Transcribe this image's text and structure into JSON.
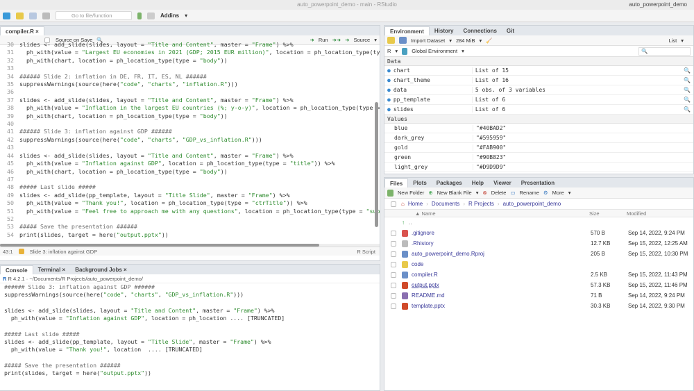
{
  "window": {
    "title": "auto_powerpoint_demo - main - RStudio",
    "project": "auto_powerpoint_demo"
  },
  "toolbar": {
    "goto_placeholder": "Go to file/function",
    "addins": "Addins"
  },
  "editor": {
    "tab": "compiler.R",
    "source_on_save": "Source on Save",
    "run": "Run",
    "source": "Source",
    "first_line": 30,
    "lines": [
      "slides <- add_slide(slides, layout = \"Title and Content\", master = \"Frame\") %>%",
      "  ph_with(value = \"Largest EU economies in 2021 (GDP; 2015 EUR million)\", location = ph_location_type(type",
      "  ph_with(chart, location = ph_location_type(type = \"body\"))",
      "",
      "###### Slide 2: inflation in DE, FR, IT, ES, NL ######",
      "suppressWarnings(source(here(\"code\", \"charts\", \"inflation.R\")))",
      "",
      "slides <- add_slide(slides, layout = \"Title and Content\", master = \"Frame\") %>%",
      "  ph_with(value = \"Inflation in the largest EU countries (%; y-o-y)\", location = ph_location_type(type = \"",
      "  ph_with(chart, location = ph_location_type(type = \"body\"))",
      "",
      "###### Slide 3: inflation against GDP ######",
      "suppressWarnings(source(here(\"code\", \"charts\", \"GDP_vs_inflation.R\")))",
      "",
      "slides <- add_slide(slides, layout = \"Title and Content\", master = \"Frame\") %>%",
      "  ph_with(value = \"Inflation against GDP\", location = ph_location_type(type = \"title\")) %>%",
      "  ph_with(chart, location = ph_location_type(type = \"body\"))",
      "",
      "##### Last slide #####",
      "slides <- add_slide(pp_template, layout = \"Title Slide\", master = \"Frame\") %>%",
      "  ph_with(value = \"Thank you!\", location = ph_location_type(type = \"ctrTitle\")) %>%",
      "  ph_with(value = \"Feel free to approach me with any questions\", location = ph_location_type(type = \"subTi",
      "",
      "##### Save the presentation ######",
      "print(slides, target = here(\"output.pptx\"))"
    ],
    "status_pos": "43:1",
    "status_section": "Slide 3: inflation against GDP",
    "status_type": "R Script"
  },
  "console": {
    "tabs": [
      "Console",
      "Terminal",
      "Background Jobs"
    ],
    "path": "R 4.2.1 · ~/Documents/R Projects/auto_powerpoint_demo/",
    "lines": [
      "###### Slide 3: inflation against GDP ######",
      "suppressWarnings(source(here(\"code\", \"charts\", \"GDP_vs_inflation.R\")))",
      "",
      "slides <- add_slide(slides, layout = \"Title and Content\", master = \"Frame\") %>%",
      "  ph_with(value = \"Inflation against GDP\", location = ph_location .... [TRUNCATED]",
      "",
      "##### Last slide #####",
      "slides <- add_slide(pp_template, layout = \"Title Slide\", master = \"Frame\") %>%",
      "  ph_with(value = \"Thank you!\", location  .... [TRUNCATED]",
      "",
      "##### Save the presentation ######",
      "print(slides, target = here(\"output.pptx\"))"
    ]
  },
  "environment": {
    "tabs": [
      "Environment",
      "History",
      "Connections",
      "Git"
    ],
    "import": "Import Dataset",
    "memory": "284 MiB",
    "view": "List",
    "lang": "R",
    "scope": "Global Environment",
    "data_header": "Data",
    "data": [
      [
        "chart",
        "List of  15"
      ],
      [
        "chart_theme",
        "List of  16"
      ],
      [
        "data",
        "5 obs. of 3 variables"
      ],
      [
        "pp_template",
        "List of  6"
      ],
      [
        "slides",
        "List of  6"
      ]
    ],
    "values_header": "Values",
    "values": [
      [
        "blue",
        "\"#40BAD2\""
      ],
      [
        "dark_grey",
        "\"#595959\""
      ],
      [
        "gold",
        "\"#FAB900\""
      ],
      [
        "green",
        "\"#90B823\""
      ],
      [
        "light_grey",
        "\"#D9D9D9\""
      ]
    ]
  },
  "files": {
    "tabs": [
      "Files",
      "Plots",
      "Packages",
      "Help",
      "Viewer",
      "Presentation"
    ],
    "toolbar": {
      "new_folder": "New Folder",
      "new_file": "New Blank File",
      "delete": "Delete",
      "rename": "Rename",
      "more": "More"
    },
    "breadcrumb": [
      "Home",
      "Documents",
      "R Projects",
      "auto_powerpoint_demo"
    ],
    "columns": {
      "name": "Name",
      "size": "Size",
      "modified": "Modified"
    },
    "up": "..",
    "rows": [
      {
        "name": ".gitignore",
        "size": "570 B",
        "modified": "Sep 14, 2022, 9:24 PM",
        "color": "#d9534f"
      },
      {
        "name": ".Rhistory",
        "size": "12.7 KB",
        "modified": "Sep 15, 2022, 12:25 AM",
        "color": "#bbbbbb"
      },
      {
        "name": "auto_powerpoint_demo.Rproj",
        "size": "205 B",
        "modified": "Sep 15, 2022, 10:30 PM",
        "color": "#6a8fc8"
      },
      {
        "name": "code",
        "size": "",
        "modified": "",
        "color": "#e8c94a"
      },
      {
        "name": "compiler.R",
        "size": "2.5 KB",
        "modified": "Sep 15, 2022, 11:43 PM",
        "color": "#6a8fc8"
      },
      {
        "name": "output.pptx",
        "size": "57.3 KB",
        "modified": "Sep 15, 2022, 11:46 PM",
        "color": "#d04a2a"
      },
      {
        "name": "README.md",
        "size": "71 B",
        "modified": "Sep 14, 2022, 9:24 PM",
        "color": "#8a6fb0"
      },
      {
        "name": "template.pptx",
        "size": "30.3 KB",
        "modified": "Sep 14, 2022, 9:30 PM",
        "color": "#d04a2a"
      }
    ]
  }
}
